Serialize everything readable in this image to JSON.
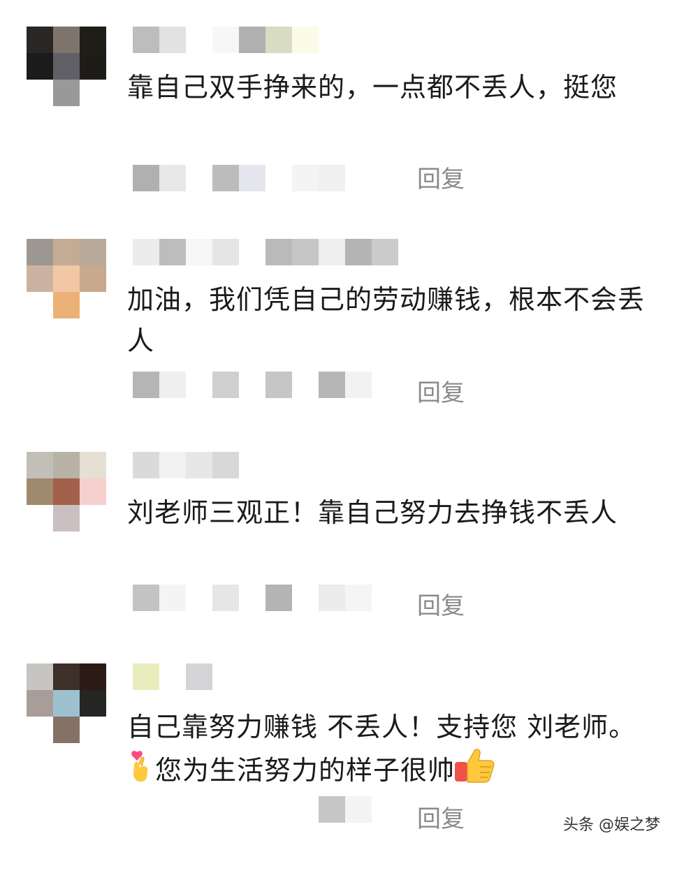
{
  "comments": [
    {
      "text": "靠自己双手挣来的，一点都不丢人，挺您",
      "reply_label": "回复",
      "avatar_pixels": [
        "#2a2623",
        "#7e746c",
        "#1e1e17",
        "#1b1b1b",
        "#616066",
        "#1d1c19",
        "#ffffff",
        "#999999",
        "#ffffff"
      ],
      "name_blocks": [
        "#bdbdbd",
        "#e2e2e2",
        "#ffffff",
        "#f7f7f7",
        "#b0b0b0",
        "#d8dcc3",
        "#fbfbe8"
      ],
      "meta_blocks": [
        "#b0b0b0",
        "#e8e8e8",
        "#ffffff",
        "#bcbcbc",
        "#e6e6ee",
        "#ffffff",
        "#f4f4f4",
        "#f0f0f0",
        "#ffffff"
      ]
    },
    {
      "text": "加油，我们凭自己的劳动赚钱，根本不会丢人",
      "reply_label": "回复",
      "avatar_pixels": [
        "#9c9790",
        "#c3ab96",
        "#b8aa9a",
        "#ccb3a1",
        "#f1c7a4",
        "#c8a98b",
        "#ffffff",
        "#ecb176",
        "#ffffff"
      ],
      "name_blocks": [
        "#ececec",
        "#bdbdbd",
        "#f6f6f6",
        "#e5e5e5",
        "#ffffff",
        "#bababa",
        "#c6c6c6",
        "#eeeeee",
        "#b4b4b4",
        "#cbcbcb"
      ],
      "meta_blocks": [
        "#b5b5b5",
        "#efefef",
        "#ffffff",
        "#cfcfcf",
        "#ffffff",
        "#c6c6c6",
        "#ffffff",
        "#b6b6b6",
        "#f2f2f2"
      ]
    },
    {
      "text": "刘老师三观正！靠自己努力去挣钱不丢人",
      "reply_label": "回复",
      "avatar_pixels": [
        "#c2bfb9",
        "#b8b3a6",
        "#e6dfd3",
        "#a08a6e",
        "#a3614c",
        "#f6d0cf",
        "#ffffff",
        "#cbc0c1",
        "#ffffff"
      ],
      "name_blocks": [
        "#dadada",
        "#f2f2f2",
        "#e7e7e7",
        "#d8d8d8",
        "#ffffff"
      ],
      "meta_blocks": [
        "#c3c3c3",
        "#f4f4f4",
        "#ffffff",
        "#e6e6e6",
        "#ffffff",
        "#b4b4b4",
        "#ffffff",
        "#ececec",
        "#f5f5f5"
      ]
    },
    {
      "text": "自己靠努力赚钱 不丢人！支持您 刘老师。",
      "text_tail": "您为生活努力的样子很帅",
      "reply_label": "回复",
      "avatar_pixels": [
        "#c7c5c2",
        "#3d3029",
        "#2b1b14",
        "#a99d99",
        "#9ec1cf",
        "#252624",
        "#ffffff",
        "#847267",
        "#ffffff"
      ],
      "name_blocks": [
        "#e9ecbd",
        "#ffffff",
        "#d4d4d6"
      ],
      "meta_blocks": [
        "#ffffff",
        "#ffffff",
        "#ffffff",
        "#ffffff",
        "#ffffff",
        "#ffffff",
        "#ffffff",
        "#c6c6c6",
        "#f4f4f4"
      ]
    }
  ],
  "watermark": {
    "label": "头条 @娱之梦"
  }
}
